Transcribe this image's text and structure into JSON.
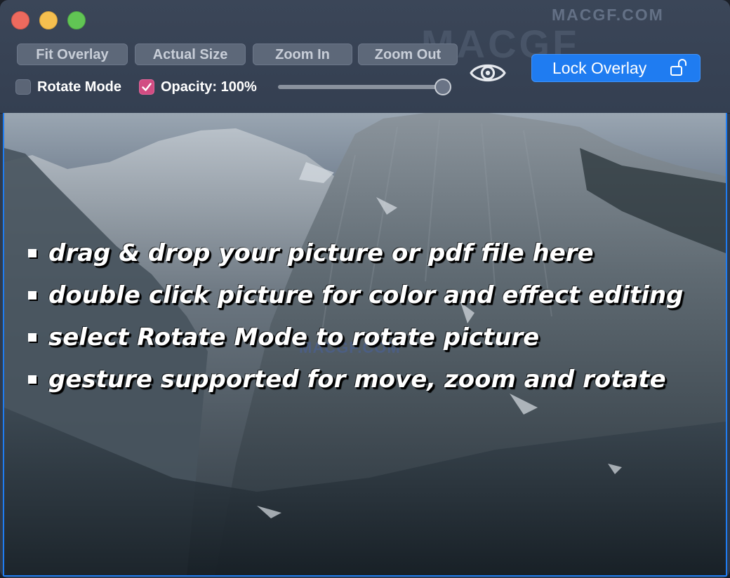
{
  "toolbar": {
    "buttons": {
      "fit_overlay": "Fit Overlay",
      "actual_size": "Actual Size",
      "zoom_in": "Zoom In",
      "zoom_out": "Zoom Out"
    },
    "rotate_mode": {
      "label": "Rotate Mode",
      "checked": false
    },
    "opacity": {
      "label": "Opacity: 100%",
      "checked": true,
      "value_percent": 100
    },
    "lock_overlay": {
      "label": "Lock Overlay",
      "icon": "unlocked-padlock-icon"
    },
    "visibility_icon": "eye-icon"
  },
  "watermarks": {
    "top": "MACGF.COM",
    "large": "MACGF",
    "middle": "MACGF.COM"
  },
  "overlay": {
    "background": "mountain landscape photo",
    "hints": [
      "drag & drop your picture or pdf file here",
      "double click picture for color and effect editing",
      "select Rotate Mode to rotate picture",
      "gesture supported for move, zoom and rotate"
    ]
  },
  "colors": {
    "accent": "#1f7cf1",
    "checkbox_checked": "#d24c82",
    "close": "#ed6a5e",
    "minimize": "#f5bf4f",
    "maximize": "#61c554"
  }
}
